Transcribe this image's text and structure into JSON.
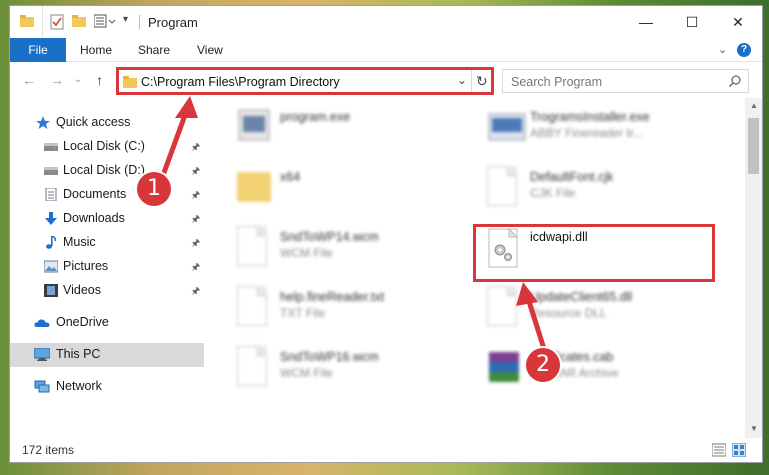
{
  "window": {
    "title": "Program",
    "minimize_glyph": "—",
    "maximize_glyph": "☐",
    "close_glyph": "✕"
  },
  "ribbon": {
    "tabs": [
      {
        "label": "File"
      },
      {
        "label": "Home"
      },
      {
        "label": "Share"
      },
      {
        "label": "View"
      }
    ],
    "help_glyph": "?"
  },
  "navigation": {
    "back_glyph": "←",
    "forward_glyph": "→",
    "up_glyph": "↑",
    "address_path": "C:\\Program Files\\Program Directory",
    "dropdown_glyph": "⌄",
    "refresh_glyph": "↻",
    "search_placeholder": "Search Program"
  },
  "sidebar": {
    "items": [
      {
        "label": "Quick access",
        "icon": "star-icon"
      },
      {
        "label": "Local Disk (C:)",
        "icon": "drive-icon",
        "pinned": true
      },
      {
        "label": "Local Disk (D:)",
        "icon": "drive-icon",
        "pinned": true
      },
      {
        "label": "Documents",
        "icon": "documents-icon",
        "pinned": true
      },
      {
        "label": "Downloads",
        "icon": "download-icon",
        "pinned": true
      },
      {
        "label": "Music",
        "icon": "music-icon",
        "pinned": true
      },
      {
        "label": "Pictures",
        "icon": "pictures-icon",
        "pinned": true
      },
      {
        "label": "Videos",
        "icon": "videos-icon",
        "pinned": true
      },
      {
        "label": "OneDrive",
        "icon": "cloud-icon"
      },
      {
        "label": "This PC",
        "icon": "computer-icon",
        "selected": true
      },
      {
        "label": "Network",
        "icon": "network-icon"
      }
    ],
    "pin_glyph": "📌"
  },
  "files": [
    {
      "name": "program.exe",
      "type": ""
    },
    {
      "name": "TrogramsInstaller.exe",
      "type": "ABBY Finereader tr..."
    },
    {
      "name": "x64",
      "type": ""
    },
    {
      "name": "DefaultFont.cjk",
      "type": "CJK File"
    },
    {
      "name": "SndToWP14.wcm",
      "type": "WCM File"
    },
    {
      "name": "icdwapi.dll",
      "type": ""
    },
    {
      "name": "help.fineReader.txt",
      "type": "TXT File"
    },
    {
      "name": "UpdateClient65.dll",
      "type": "Resource DLL"
    },
    {
      "name": "SndToWP16.wcm",
      "type": "WCM File"
    },
    {
      "name": "certificates.cab",
      "type": "WinRAR Archive"
    }
  ],
  "status": {
    "item_count": "172 items"
  },
  "annotations": {
    "step1": "1",
    "step2": "2",
    "color": "#d9363b"
  }
}
